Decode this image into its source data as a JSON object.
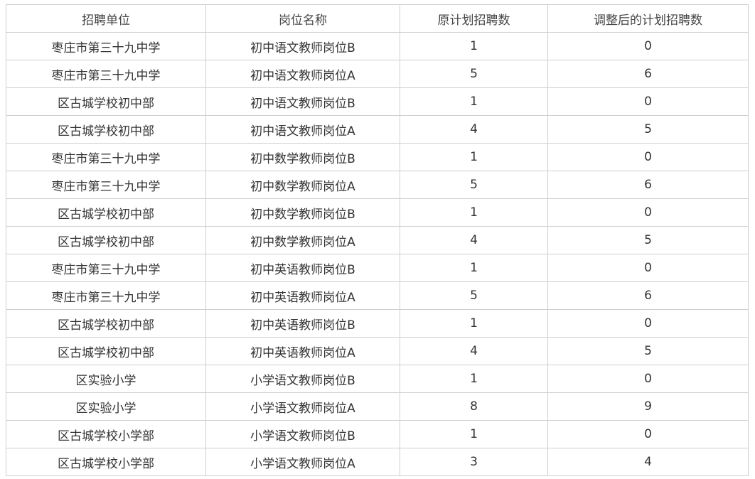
{
  "table": {
    "headers": [
      "招聘单位",
      "岗位名称",
      "原计划招聘数",
      "调整后的计划招聘数"
    ],
    "rows": [
      [
        "枣庄市第三十九中学",
        "初中语文教师岗位B",
        "1",
        "0"
      ],
      [
        "枣庄市第三十九中学",
        "初中语文教师岗位A",
        "5",
        "6"
      ],
      [
        "区古城学校初中部",
        "初中语文教师岗位B",
        "1",
        "0"
      ],
      [
        "区古城学校初中部",
        "初中语文教师岗位A",
        "4",
        "5"
      ],
      [
        "枣庄市第三十九中学",
        "初中数学教师岗位B",
        "1",
        "0"
      ],
      [
        "枣庄市第三十九中学",
        "初中数学教师岗位A",
        "5",
        "6"
      ],
      [
        "区古城学校初中部",
        "初中数学教师岗位B",
        "1",
        "0"
      ],
      [
        "区古城学校初中部",
        "初中数学教师岗位A",
        "4",
        "5"
      ],
      [
        "枣庄市第三十九中学",
        "初中英语教师岗位B",
        "1",
        "0"
      ],
      [
        "枣庄市第三十九中学",
        "初中英语教师岗位A",
        "5",
        "6"
      ],
      [
        "区古城学校初中部",
        "初中英语教师岗位B",
        "1",
        "0"
      ],
      [
        "区古城学校初中部",
        "初中英语教师岗位A",
        "4",
        "5"
      ],
      [
        "区实验小学",
        "小学语文教师岗位B",
        "1",
        "0"
      ],
      [
        "区实验小学",
        "小学语文教师岗位A",
        "8",
        "9"
      ],
      [
        "区古城学校小学部",
        "小学语文教师岗位B",
        "1",
        "0"
      ],
      [
        "区古城学校小学部",
        "小学语文教师岗位A",
        "3",
        "4"
      ]
    ]
  }
}
